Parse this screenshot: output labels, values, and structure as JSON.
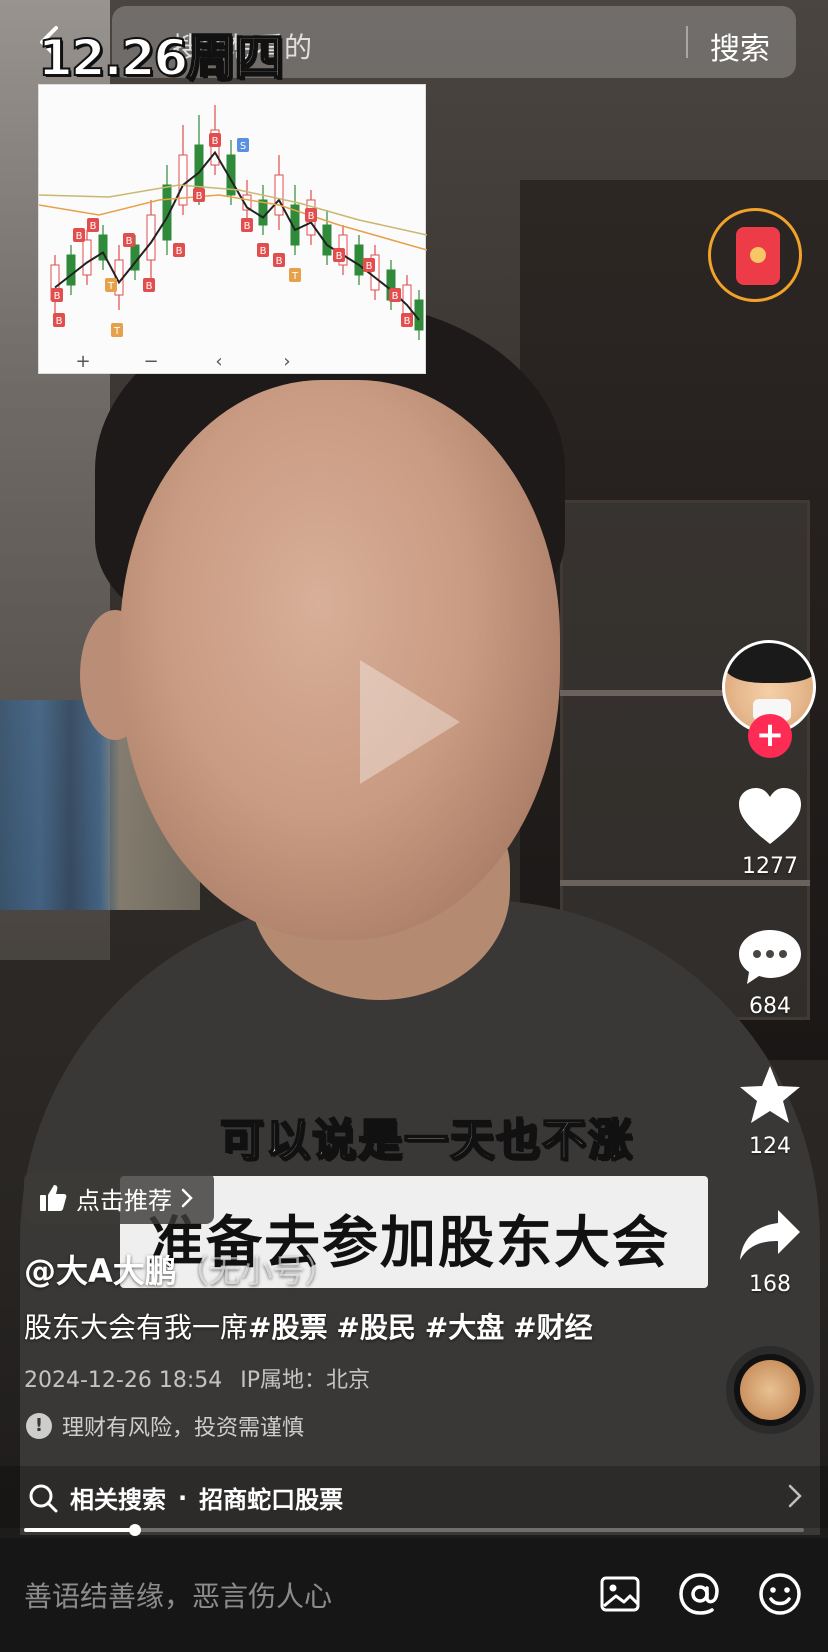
{
  "top_bar": {
    "date_overlay": "12.26周四",
    "search_placeholder": "搜你想看的",
    "search_button": "搜索"
  },
  "inset_chart": {
    "type": "candlestick",
    "axis_controls": [
      "+",
      "−",
      "‹",
      "›"
    ],
    "buy_marker": "B",
    "sell_marker": "S",
    "t_marker": "T",
    "colors": {
      "up": "#e24d4d",
      "down": "#2f8a3a",
      "ma_black": "#222222",
      "ma_orange": "#e6a14a",
      "ma_yellow": "#c8b870"
    }
  },
  "actions": {
    "like_count": "1277",
    "comment_count": "684",
    "favorite_count": "124",
    "share_count": "168",
    "follow_symbol": "+"
  },
  "captions": {
    "line1": "可以说是一天也不涨",
    "line2": "准备去参加股东大会"
  },
  "recommend": {
    "label": "点击推荐"
  },
  "author": {
    "name": "@大A大鹏",
    "suffix": "（无小号）"
  },
  "description": {
    "text": "股东大会有我一席",
    "tags": [
      "#股票",
      "#股民",
      "#大盘",
      "#财经"
    ]
  },
  "meta": {
    "datetime": "2024-12-26 18:54",
    "ip_location": "IP属地：北京"
  },
  "risk": {
    "icon_symbol": "!",
    "text": "理财有风险，投资需谨慎"
  },
  "related_search": {
    "label": "相关搜索",
    "separator": "·",
    "query": "招商蛇口股票"
  },
  "progress": {
    "fraction": 0.142
  },
  "comment_bar": {
    "placeholder": "善语结善缘，恶言伤人心"
  }
}
